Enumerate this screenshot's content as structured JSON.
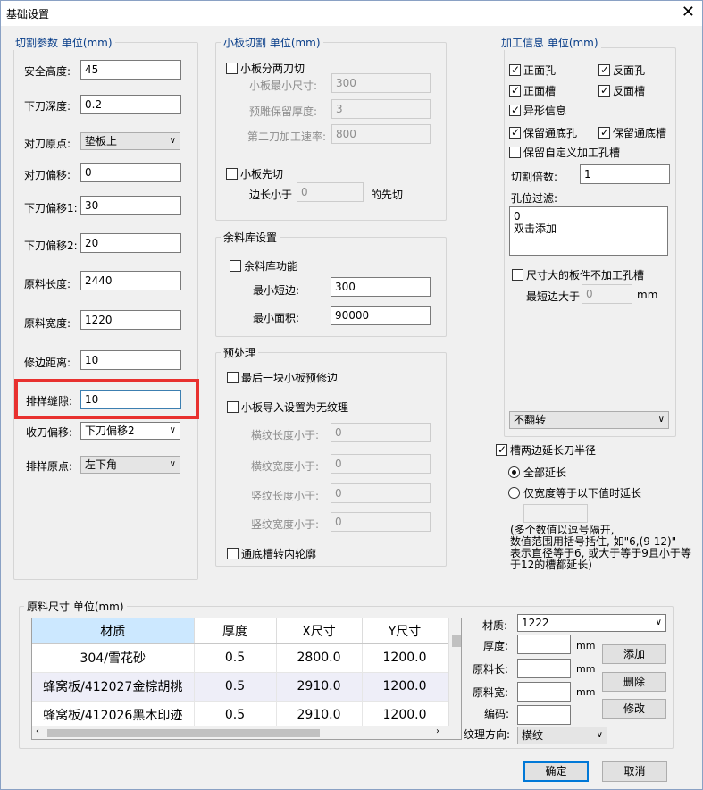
{
  "window": {
    "title": "基础设置"
  },
  "cut_params": {
    "title": "切割参数 单位(mm)",
    "fields": [
      {
        "label": "安全高度:",
        "value": "45"
      },
      {
        "label": "下刀深度:",
        "value": "0.2"
      },
      {
        "label": "对刀原点:",
        "value": "垫板上"
      },
      {
        "label": "对刀偏移:",
        "value": "0"
      },
      {
        "label": "下刀偏移1:",
        "value": "30"
      },
      {
        "label": "下刀偏移2:",
        "value": "20"
      },
      {
        "label": "原料长度:",
        "value": "2440"
      },
      {
        "label": "原料宽度:",
        "value": "1220"
      },
      {
        "label": "修边距离:",
        "value": "10"
      },
      {
        "label": "排样缝隙:",
        "value": "10"
      },
      {
        "label": "收刀偏移:",
        "value": "下刀偏移2"
      },
      {
        "label": "排样原点:",
        "value": "左下角"
      }
    ]
  },
  "small_cut": {
    "title": "小板切割 单位(mm)",
    "split_cut_label": "小板分两刀切",
    "min_size_label": "小板最小尺寸:",
    "min_size_value": "300",
    "reserve_label": "预雕保留厚度:",
    "reserve_value": "3",
    "speed_label": "第二刀加工速率:",
    "speed_value": "800",
    "first_cut_label": "小板先切",
    "edge_prefix": "边长小于",
    "edge_value": "0",
    "edge_suffix": "的先切"
  },
  "remnant": {
    "title": "余料库设置",
    "enable_label": "余料库功能",
    "min_short_label": "最小短边:",
    "min_short_value": "300",
    "min_area_label": "最小面积:",
    "min_area_value": "90000"
  },
  "preprocess": {
    "title": "预处理",
    "last_trim_label": "最后一块小板预修边",
    "no_texture_label": "小板导入设置为无纹理",
    "h_len_label": "横纹长度小于:",
    "h_len_value": "0",
    "h_wid_label": "横纹宽度小于:",
    "h_wid_value": "0",
    "v_len_label": "竖纹长度小于:",
    "v_len_value": "0",
    "v_wid_label": "竖纹宽度小于:",
    "v_wid_value": "0",
    "groove_label": "通底槽转内轮廓"
  },
  "process_info": {
    "title": "加工信息 单位(mm)",
    "front_hole": "正面孔",
    "back_hole": "反面孔",
    "front_groove": "正面槽",
    "back_groove": "反面槽",
    "special": "异形信息",
    "keep_through_hole": "保留通底孔",
    "keep_through_groove": "保留通底槽",
    "keep_custom": "保留自定义加工孔槽",
    "multiple_label": "切割倍数:",
    "multiple_value": "1",
    "filter_label": "孔位过滤:",
    "filter_lines": [
      "0",
      "双击添加"
    ],
    "big_board_label": "尺寸大的板件不加工孔槽",
    "min_short_label": "最短边大于",
    "min_short_value": "0",
    "unit": "mm",
    "flip_value": "不翻转"
  },
  "groove_ext": {
    "label": "槽两边延长刀半径",
    "all_label": "全部延长",
    "width_label": "仅宽度等于以下值时延长",
    "note": [
      "(多个数值以逗号隔开,",
      "数值范围用括号括住, 如\"6,(9 12)\"",
      "表示直径等于6, 或大于等于9且小于等",
      "于12的槽都延长)"
    ]
  },
  "material": {
    "title": "原料尺寸 单位(mm)",
    "columns": [
      "材质",
      "厚度",
      "X尺寸",
      "Y尺寸"
    ],
    "rows": [
      [
        "304/雪花砂",
        "0.5",
        "2800.0",
        "1200.0"
      ],
      [
        "蜂窝板/412027金棕胡桃",
        "0.5",
        "2910.0",
        "1200.0"
      ],
      [
        "蜂窝板/412026黑木印迹",
        "0.5",
        "2910.0",
        "1200.0"
      ]
    ],
    "form": {
      "material_label": "材质:",
      "material_value": "1222",
      "thickness_label": "厚度:",
      "length_label": "原料长:",
      "width_label": "原料宽:",
      "code_label": "编码:",
      "dir_label": "纹理方向:",
      "dir_value": "横纹",
      "unit": "mm"
    },
    "add": "添加",
    "delete": "删除",
    "modify": "修改"
  },
  "footer": {
    "ok": "确定",
    "cancel": "取消"
  }
}
